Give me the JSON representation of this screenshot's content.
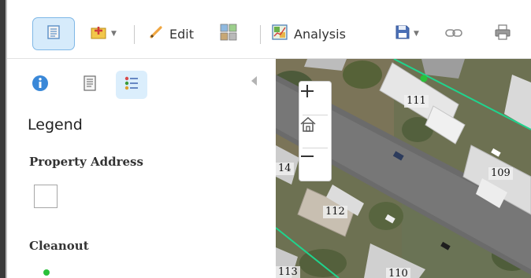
{
  "toolbar": {
    "edit_label": "Edit",
    "analysis_label": "Analysis"
  },
  "panel": {
    "title": "Legend",
    "layers": [
      {
        "title": "Property Address"
      },
      {
        "title": "Cleanout"
      }
    ]
  },
  "map": {
    "parcels": [
      "111",
      "109",
      "112",
      "14",
      "113",
      "110"
    ]
  },
  "colors": {
    "accent": "#4a90d9",
    "cleanout_point": "#2ac13a",
    "parcel_line": "#1fd48e"
  }
}
